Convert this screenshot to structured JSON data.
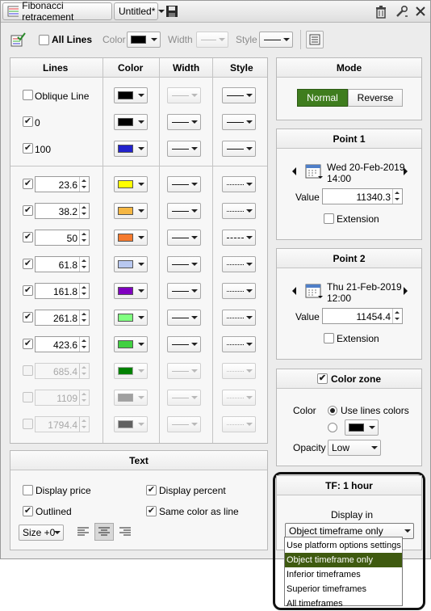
{
  "window": {
    "title": "Fibonacci retracement",
    "template": "Untitled*"
  },
  "toolbar": {
    "all_lines": "All Lines",
    "color": "Color",
    "width": "Width",
    "style": "Style"
  },
  "lines": {
    "headers": [
      "Lines",
      "Color",
      "Width",
      "Style"
    ],
    "top": [
      {
        "label": "Oblique Line",
        "checked": false,
        "color": "#000000",
        "width_disabled": true
      },
      {
        "label": "0",
        "checked": true,
        "color": "#000000",
        "width_disabled": false
      },
      {
        "label": "100",
        "checked": true,
        "color": "#2222cc",
        "width_disabled": false
      }
    ],
    "levels": [
      {
        "value": "23.6",
        "checked": true,
        "color": "#ffff00",
        "style": "dotted",
        "enabled": true
      },
      {
        "value": "38.2",
        "checked": true,
        "color": "#f5b642",
        "style": "dotted",
        "enabled": true
      },
      {
        "value": "50",
        "checked": true,
        "color": "#f57a2e",
        "style": "dashdot",
        "enabled": true
      },
      {
        "value": "61.8",
        "checked": true,
        "color": "#b8c8f0",
        "style": "dotted",
        "enabled": true
      },
      {
        "value": "161.8",
        "checked": true,
        "color": "#8000c0",
        "style": "dotted",
        "enabled": true
      },
      {
        "value": "261.8",
        "checked": true,
        "color": "#80ff80",
        "style": "dotted",
        "enabled": true
      },
      {
        "value": "423.6",
        "checked": true,
        "color": "#40d040",
        "style": "dotted",
        "enabled": true
      },
      {
        "value": "685.4",
        "checked": false,
        "color": "#008000",
        "style": "dotted",
        "enabled": false
      },
      {
        "value": "1109",
        "checked": false,
        "color": "#a0a0a0",
        "style": "dotted",
        "enabled": false
      },
      {
        "value": "1794.4",
        "checked": false,
        "color": "#606060",
        "style": "dotted",
        "enabled": false
      }
    ]
  },
  "text_panel": {
    "title": "Text",
    "display_price": "Display price",
    "display_percent": "Display percent",
    "outlined": "Outlined",
    "same_color": "Same color as line",
    "size": "Size +0"
  },
  "mode": {
    "title": "Mode",
    "normal": "Normal",
    "reverse": "Reverse"
  },
  "point1": {
    "title": "Point 1",
    "date": "Wed 20-Feb-2019",
    "time": "14:00",
    "value_label": "Value",
    "value": "11340.3",
    "extension": "Extension"
  },
  "point2": {
    "title": "Point 2",
    "date": "Thu 21-Feb-2019",
    "time": "12:00",
    "value_label": "Value",
    "value": "11454.4",
    "extension": "Extension"
  },
  "color_zone": {
    "title": "Color zone",
    "color_label": "Color",
    "use_lines_colors": "Use lines colors",
    "opacity_label": "Opacity",
    "opacity": "Low"
  },
  "tf": {
    "title": "TF: 1 hour",
    "display_in": "Display in",
    "selected": "Object timeframe only",
    "options": [
      "Use platform options settings",
      "Object timeframe only",
      "Inferior timeframes",
      "Superior timeframes",
      "All timeframes"
    ]
  },
  "colors": {
    "accent_green": "#3f7d1e",
    "selection": "#3f5a10"
  }
}
